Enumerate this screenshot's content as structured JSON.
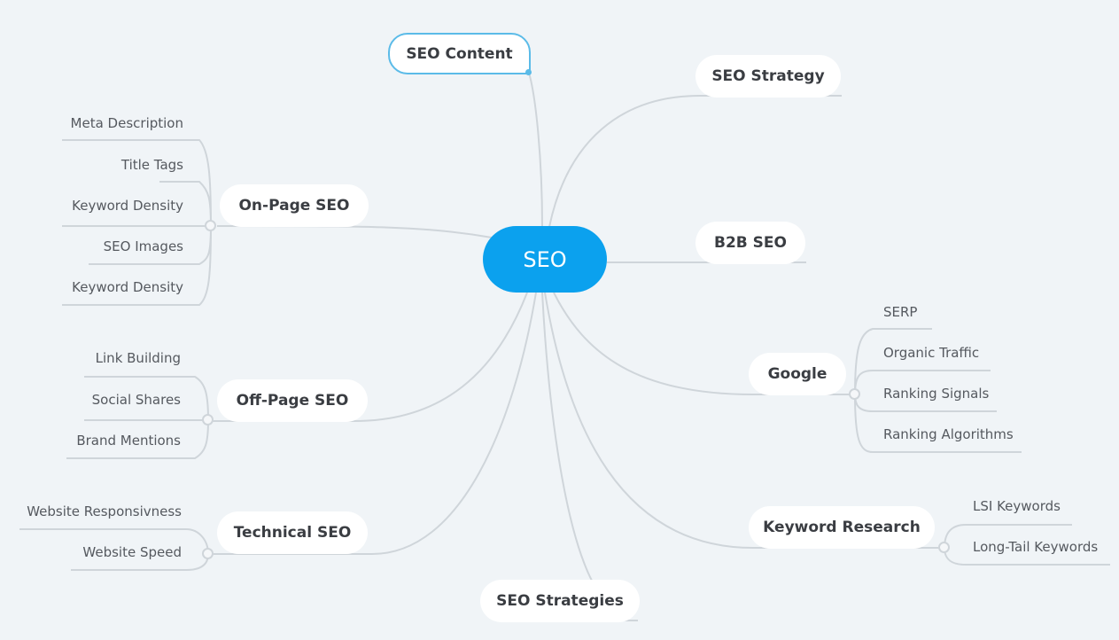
{
  "root": {
    "label": "SEO",
    "color": "#0ba1ee"
  },
  "topics": {
    "seo_content": {
      "label": "SEO Content",
      "selected": true
    },
    "seo_strategy": {
      "label": "SEO Strategy"
    },
    "on_page": {
      "label": "On-Page SEO",
      "children": [
        "Meta Description",
        "Title Tags",
        "Keyword Density",
        "SEO Images",
        "Keyword Density"
      ]
    },
    "b2b": {
      "label": "B2B SEO"
    },
    "off_page": {
      "label": "Off-Page SEO",
      "children": [
        "Link Building",
        "Social Shares",
        "Brand Mentions"
      ]
    },
    "google": {
      "label": "Google",
      "children": [
        "SERP",
        "Organic Traffic",
        "Ranking Signals",
        "Ranking Algorithms"
      ]
    },
    "technical": {
      "label": "Technical SEO",
      "children": [
        "Website Responsivness",
        "Website Speed"
      ]
    },
    "keyword_research": {
      "label": "Keyword Research",
      "children": [
        "LSI Keywords",
        "Long-Tail Keywords"
      ]
    },
    "seo_strategies": {
      "label": "SEO Strategies"
    }
  },
  "colors": {
    "background": "#f0f4f7",
    "line": "#cfd5da",
    "selection": "#5bbbe8",
    "node_text": "#3a3d42",
    "leaf_text": "#55595f"
  }
}
